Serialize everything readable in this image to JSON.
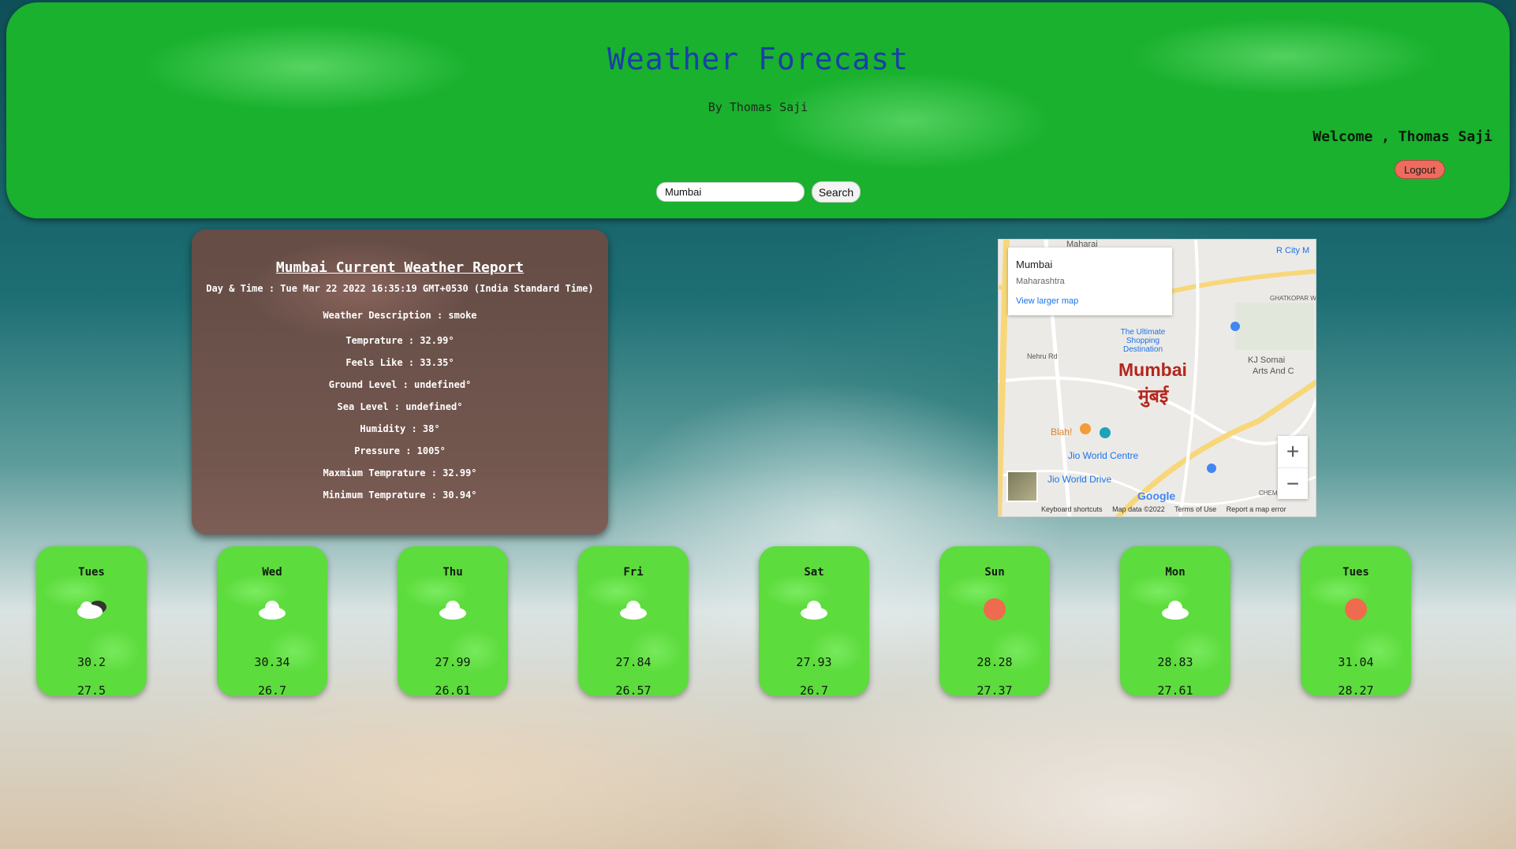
{
  "header": {
    "title": "Weather Forecast",
    "byline": "By Thomas Saji",
    "welcome": "Welcome , Thomas Saji",
    "logout_label": "Logout",
    "search_value": "Mumbai",
    "search_label": "Search",
    "color": "#19b12e"
  },
  "report": {
    "title": "Mumbai Current Weather Report",
    "lines": [
      "Day & Time : Tue Mar 22 2022 16:35:19 GMT+0530 (India Standard Time)",
      "Weather Description : smoke",
      "Temprature : 32.99°",
      "Feels Like : 33.35°",
      "Ground Level : undefined°",
      "Sea Level : undefined°",
      "Humidity : 38°",
      "Pressure : 1005°",
      "Maxmium Temprature : 32.99°",
      "Minimum Temprature : 30.94°"
    ]
  },
  "map": {
    "city": "Mumbai",
    "region": "Maharashtra",
    "link": "View larger map",
    "label_en": "Mumbai",
    "label_hi": "मुंबई",
    "places": [
      "Jio World Centre",
      "Jio World Drive",
      "Blah!",
      "Nehru Rd",
      "Maharai",
      "KJ Somai",
      "Arts And C",
      "GHATKOPAR WEST",
      "CHEMBU",
      "R City M",
      "The Ultimate Shopping Destination"
    ],
    "logo": "Google",
    "footer": [
      "Keyboard shortcuts",
      "Map data ©2022",
      "Terms of Use",
      "Report a map error"
    ],
    "zoom_in": "+",
    "zoom_out": "−"
  },
  "forecast": [
    {
      "day": "Tues",
      "icon": "few-clouds-icon",
      "max": "30.2",
      "min": "27.5"
    },
    {
      "day": "Wed",
      "icon": "cloud-icon",
      "max": "30.34",
      "min": "26.7"
    },
    {
      "day": "Thu",
      "icon": "cloud-icon",
      "max": "27.99",
      "min": "26.61"
    },
    {
      "day": "Fri",
      "icon": "cloud-icon",
      "max": "27.84",
      "min": "26.57"
    },
    {
      "day": "Sat",
      "icon": "cloud-icon",
      "max": "27.93",
      "min": "26.7"
    },
    {
      "day": "Sun",
      "icon": "sun-icon",
      "max": "28.28",
      "min": "27.37"
    },
    {
      "day": "Mon",
      "icon": "cloud-icon",
      "max": "28.83",
      "min": "27.61"
    },
    {
      "day": "Tues",
      "icon": "sun-icon",
      "max": "31.04",
      "min": "28.27"
    }
  ]
}
